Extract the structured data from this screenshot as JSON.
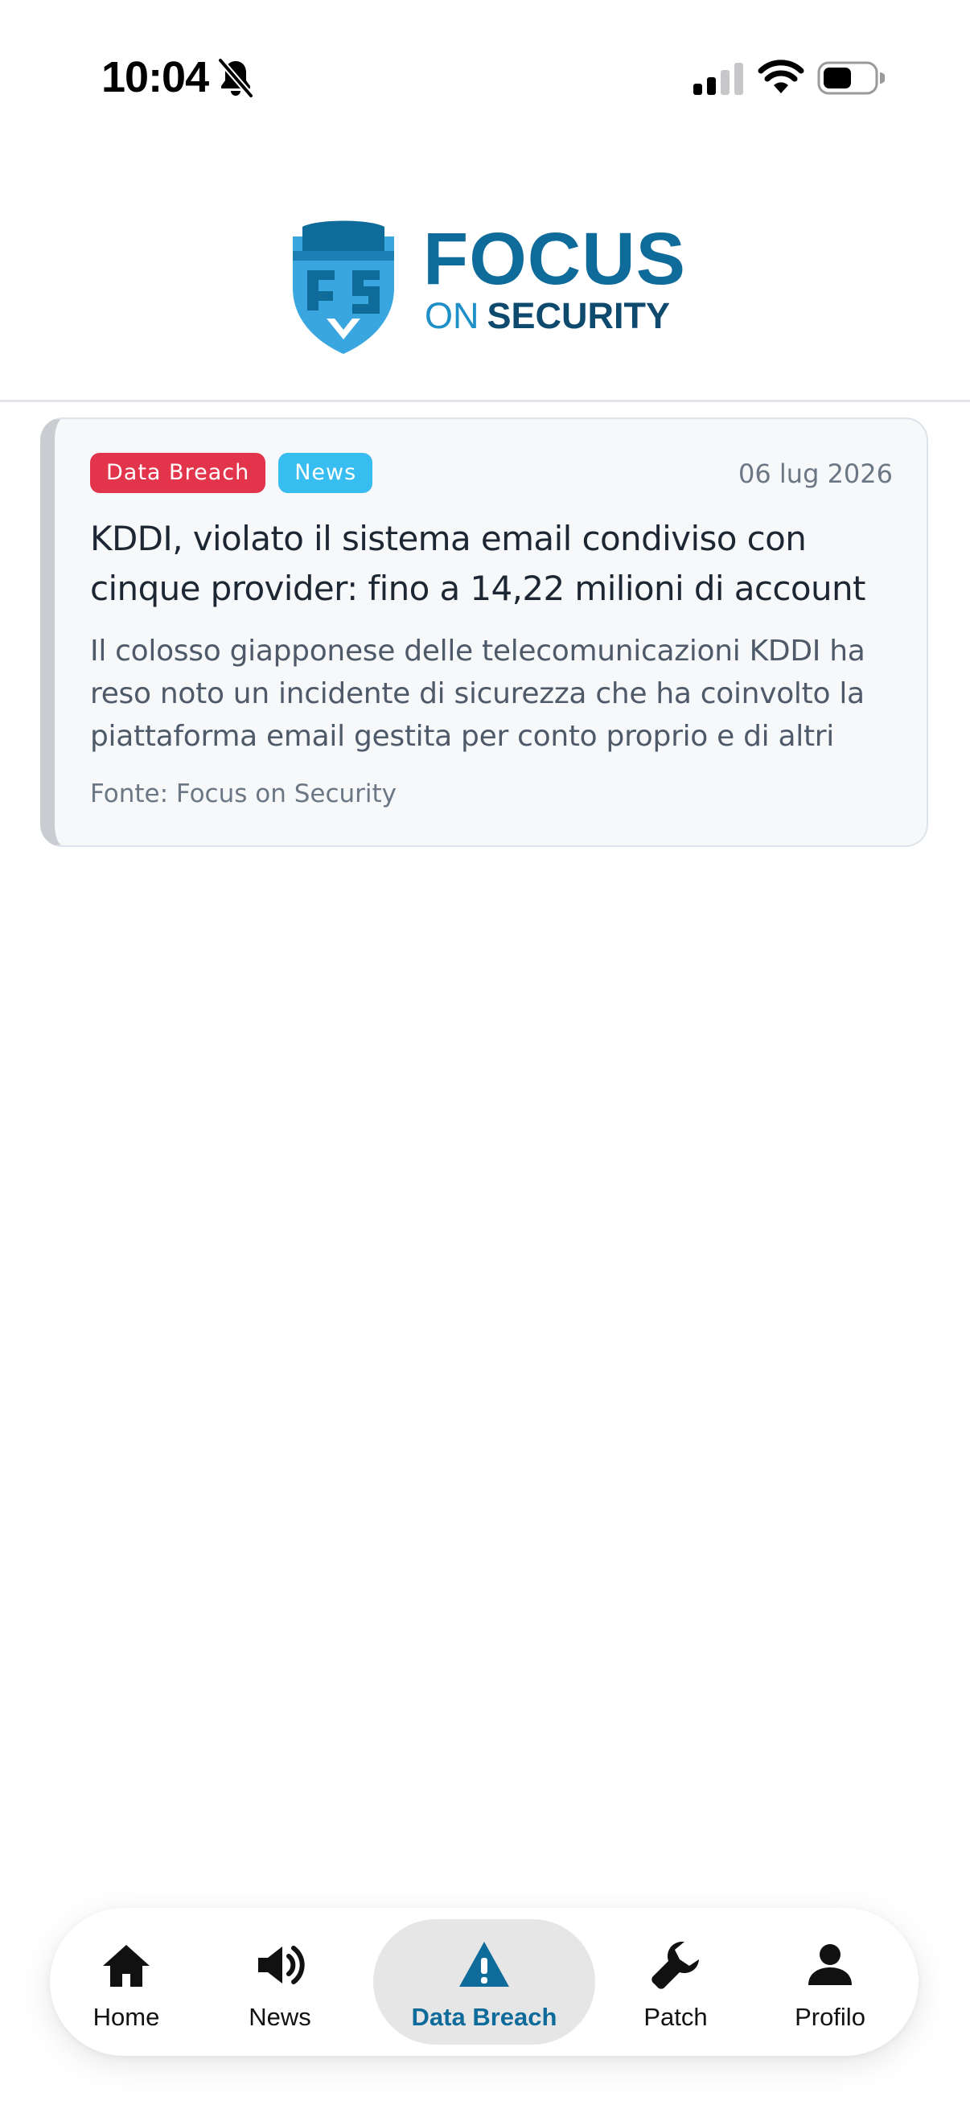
{
  "status_bar": {
    "time": "10:04"
  },
  "header": {
    "logo": {
      "word_focus": "FOCUS",
      "word_on": "ON",
      "word_security": "SECURITY"
    }
  },
  "articles": [
    {
      "tags": [
        {
          "label": "Data Breach",
          "color": "#e2344a"
        },
        {
          "label": "News",
          "color": "#38bdf0"
        }
      ],
      "date": "06 lug 2026",
      "title": "KDDI, violato il sistema email condiviso con cinque provider: fino a 14,22 milioni di account",
      "excerpt": "Il colosso giapponese delle telecomunicazioni KDDI ha reso noto un incidente di sicurezza che ha coinvolto la piattaforma email gestita per conto proprio e di altri",
      "source": "Fonte: Focus on Security"
    }
  ],
  "bottom_nav": {
    "items": [
      {
        "label": "Home",
        "icon": "home-icon"
      },
      {
        "label": "News",
        "icon": "megaphone-icon"
      },
      {
        "label": "Data Breach",
        "icon": "warning-icon",
        "active": true
      },
      {
        "label": "Patch",
        "icon": "wrench-icon"
      },
      {
        "label": "Profilo",
        "icon": "person-icon"
      }
    ],
    "active_color": "#0f6b9a"
  },
  "colors": {
    "brand": "#0f6b9a",
    "brand_light": "#1e8fc7",
    "brand_dark": "#0d4a6e"
  }
}
